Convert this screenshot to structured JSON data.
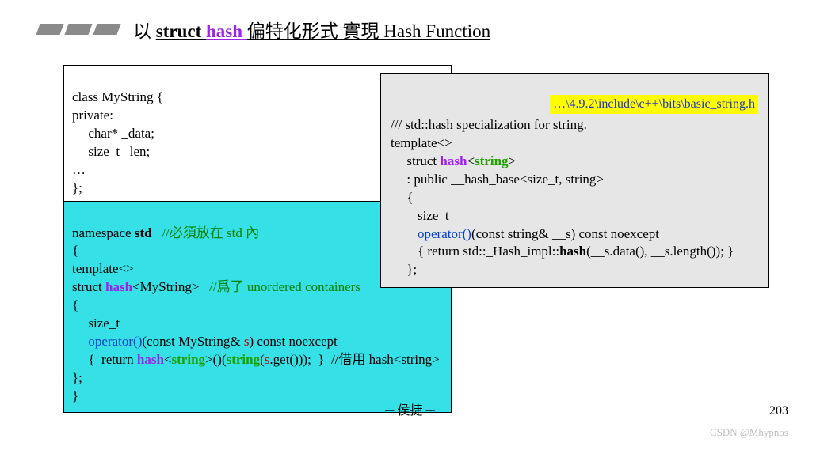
{
  "title": {
    "prefix": "以 ",
    "struct": "struct ",
    "hash": "hash ",
    "rest": "偏特化形式 實現 Hash Function"
  },
  "left": {
    "l1": "class MyString {",
    "l2": "private:",
    "l3": "char* _data;",
    "l4": "size_t _len;",
    "l5": "…",
    "l6": "};",
    "n1a": "namespace ",
    "n1b": "std",
    "n1c": "   //必須放在 std 內",
    "n2": "{",
    "n3a": "template<>",
    "n4a": "struct ",
    "n4b": "hash",
    "n4c": "<MyString>",
    "n4d": "   //爲了 unordered containers",
    "n5": "{",
    "n6": "size_t",
    "n7a": "operator()",
    "n7b": "(const MyString& ",
    "n7c": "s",
    "n7d": ") const noexcept",
    "n8a": "{  return ",
    "n8b": "hash",
    "n8c": "<",
    "n8d": "string",
    "n8e": ">()(",
    "n8f": "string",
    "n8g": "(",
    "n8h": "s",
    "n8i": ".get()));  }  //借用 hash<string>",
    "n9": "};",
    "n10": "}"
  },
  "right": {
    "file_label": "…\\4.9.2\\include\\c++\\bits\\basic_string.h",
    "r1": "/// std::hash specialization for string.",
    "r2": "template<>",
    "r3a": "struct ",
    "r3b": "hash",
    "r3c": "<",
    "r3d": "string",
    "r3e": ">",
    "r4": ": public __hash_base<size_t, string>",
    "r5": "{",
    "r6": "size_t",
    "r7a": "operator()",
    "r7b": "(const string& __s) const noexcept",
    "r8a": "{ return std::_Hash_impl::",
    "r8b": "hash",
    "r8c": "(__s.data(), __s.length()); }",
    "r9": "};"
  },
  "footer": {
    "center": "─ 侯捷 ─",
    "pagenum": "203",
    "credit": "CSDN @Mhypnos"
  }
}
